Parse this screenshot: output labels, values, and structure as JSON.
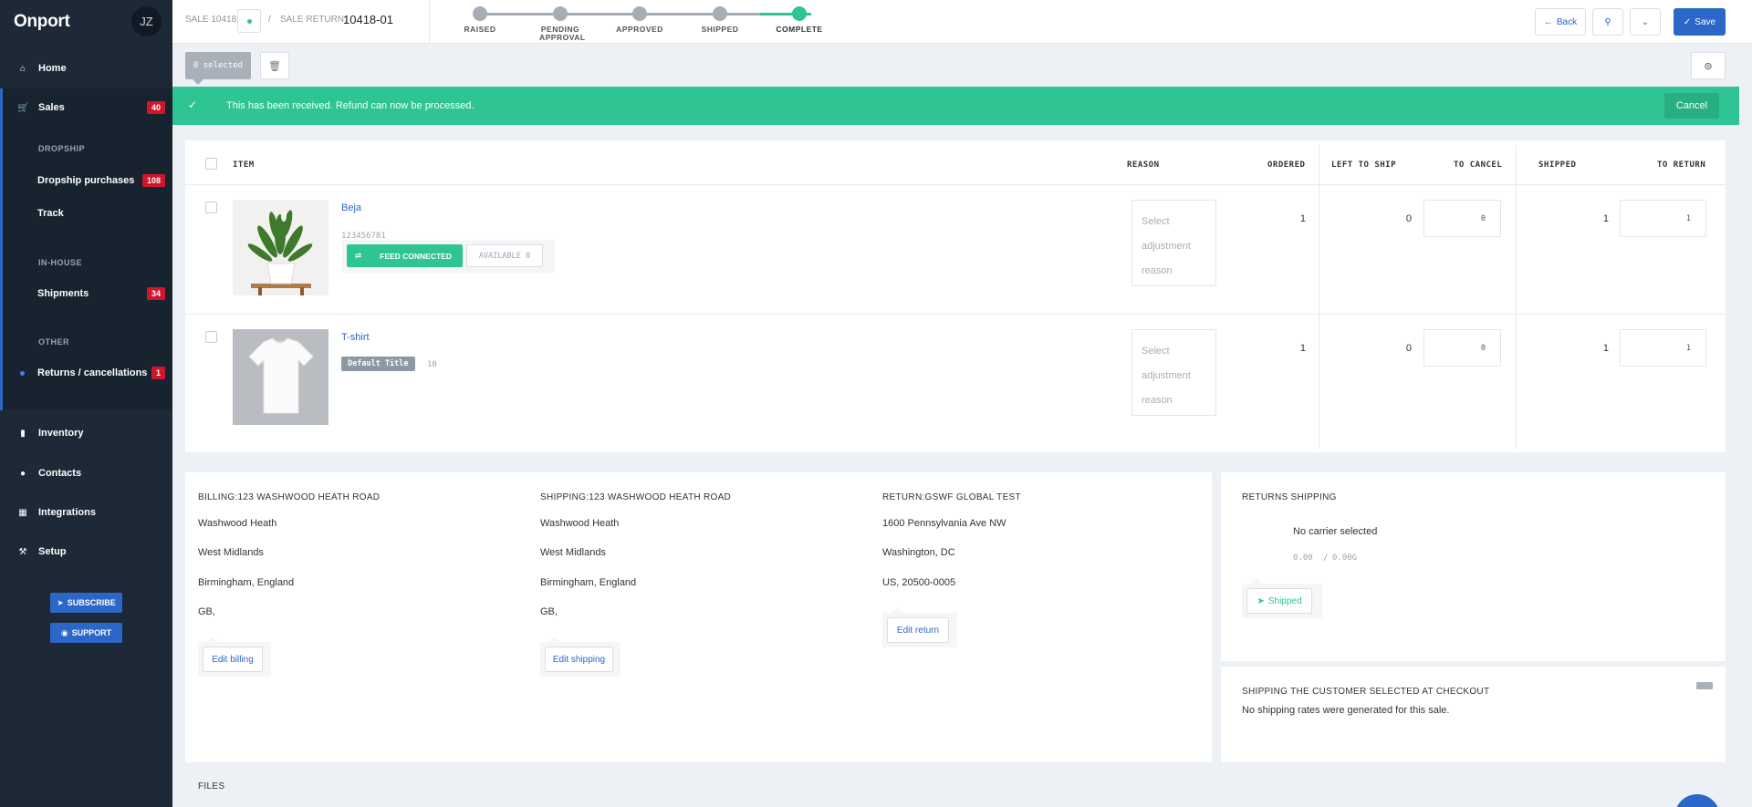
{
  "sidebar": {
    "brand": "Onport",
    "avatar_initials": "JZ",
    "home": "Home",
    "sales": "Sales",
    "sales_badge": "40",
    "section_dropship": "DROPSHIP",
    "dropship_purchases": "Dropship purchases",
    "dropship_badge": "108",
    "track": "Track",
    "section_inhouse": "IN-HOUSE",
    "shipments": "Shipments",
    "shipments_badge": "34",
    "section_other": "OTHER",
    "returns": "Returns / cancellations",
    "returns_badge": "1",
    "inventory": "Inventory",
    "contacts": "Contacts",
    "integrations": "Integrations",
    "setup": "Setup",
    "subscribe": "SUBSCRIBE",
    "support": "SUPPORT"
  },
  "topbar": {
    "sale_crumb": "SALE 10418",
    "sep": "/",
    "return_label": "SALE RETURN:",
    "return_number": "10418-01",
    "steps": [
      {
        "label": "RAISED",
        "done": false
      },
      {
        "label": "PENDING APPROVAL",
        "done": false
      },
      {
        "label": "APPROVED",
        "done": false
      },
      {
        "label": "SHIPPED",
        "done": false
      },
      {
        "label": "COMPLETE",
        "done": true
      }
    ],
    "back": "Back",
    "save": "Save"
  },
  "toolbar": {
    "selected": "0 selected"
  },
  "banner": {
    "message": "This has been received. Refund can now be processed.",
    "cancel": "Cancel"
  },
  "table": {
    "headers": {
      "item": "ITEM",
      "reason": "REASON",
      "ordered": "ORDERED",
      "left_to_ship": "LEFT TO SHIP",
      "to_cancel": "TO CANCEL",
      "shipped": "SHIPPED",
      "to_return": "TO RETURN"
    },
    "rows": [
      {
        "name": "Beja",
        "sku": "123456781",
        "feed": "FEED CONNECTED",
        "available": "AVAILABLE 0",
        "reason_placeholder": [
          "Select",
          "adjustment",
          "reason"
        ],
        "ordered": "1",
        "left_to_ship": "0",
        "to_cancel": "0",
        "shipped": "1",
        "to_return": "1"
      },
      {
        "name": "T-shirt",
        "variant": "Default Title",
        "sku": "10",
        "reason_placeholder": [
          "Select",
          "adjustment",
          "reason"
        ],
        "ordered": "1",
        "left_to_ship": "0",
        "to_cancel": "0",
        "shipped": "1",
        "to_return": "1"
      }
    ]
  },
  "addresses": {
    "billing": {
      "title": "BILLING:123 WASHWOOD HEATH ROAD",
      "lines": [
        "Washwood Heath",
        "West Midlands",
        "Birmingham, England",
        "GB,"
      ],
      "edit": "Edit billing"
    },
    "shipping": {
      "title": "SHIPPING:123 WASHWOOD HEATH ROAD",
      "lines": [
        "Washwood Heath",
        "West Midlands",
        "Birmingham, England",
        "GB,"
      ],
      "edit": "Edit shipping"
    },
    "return": {
      "title": "RETURN:GSWF GLOBAL TEST",
      "lines": [
        "1600 Pennsylvania Ave NW",
        "Washington, DC",
        "US, 20500-0005"
      ],
      "edit": "Edit return"
    }
  },
  "returns_shipping": {
    "title": "RETURNS SHIPPING",
    "carrier": "No carrier selected",
    "cost": "0.00",
    "cost_sep": "/",
    "weight": "0.00G",
    "shipped": "Shipped"
  },
  "checkout_shipping": {
    "title": "SHIPPING THE CUSTOMER SELECTED AT CHECKOUT",
    "message": "No shipping rates were generated for this sale."
  },
  "files": {
    "title": "FILES"
  },
  "colors": {
    "sidebar": "#1d2936",
    "accent": "#2b66c9",
    "success": "#2ec493",
    "danger": "#d0162b"
  }
}
